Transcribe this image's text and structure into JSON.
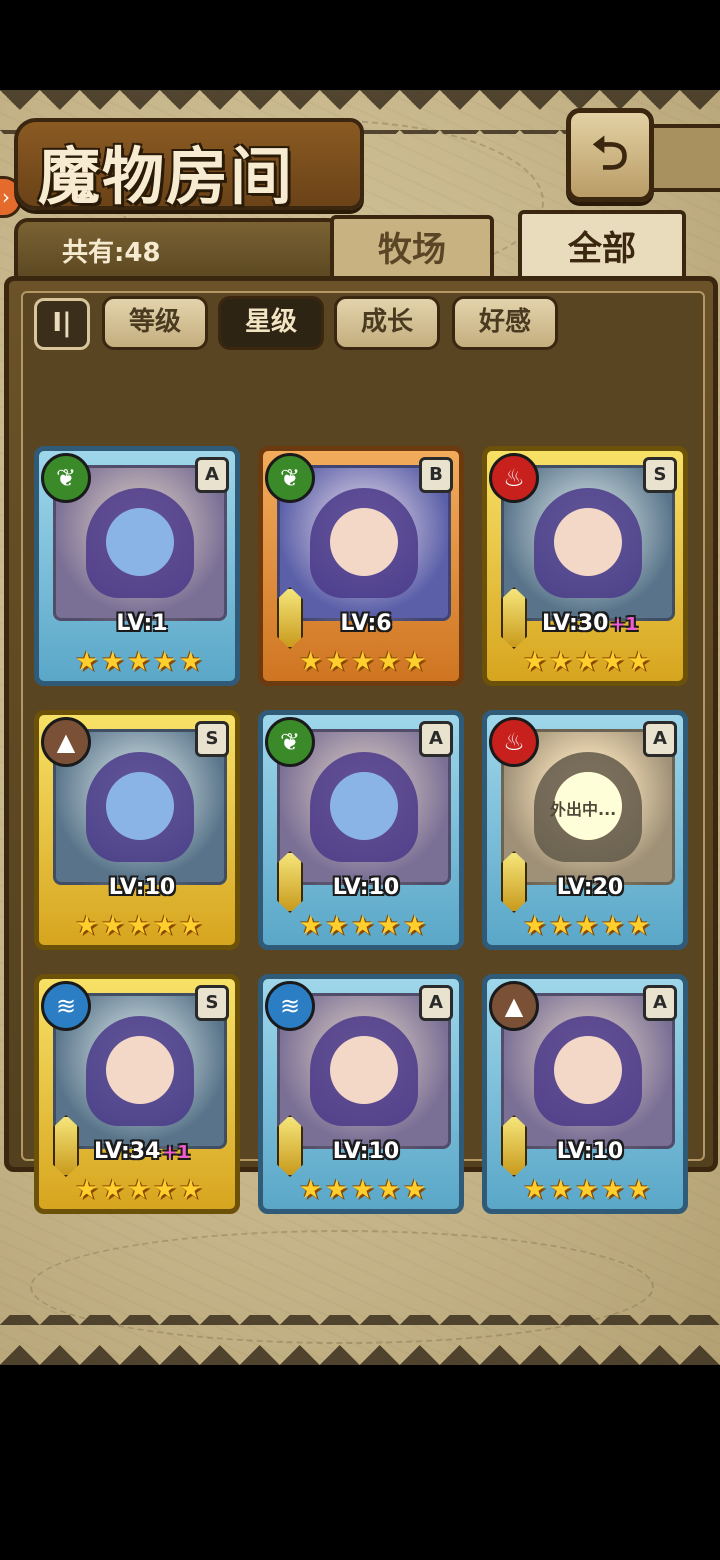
{
  "title": "魔物房间",
  "back_icon": "back-arrow-icon",
  "count_text": "共有:48",
  "tabs": [
    "牧场",
    "全部"
  ],
  "active_tab": "全部",
  "sort_toggle_label": "I|",
  "filters": [
    "等级",
    "星级",
    "成长",
    "好感"
  ],
  "active_filter": "星级",
  "cards": [
    {
      "element": "nature",
      "rank": "A",
      "level": "LV:1",
      "bonus": "",
      "stars": 5,
      "frame": "blue",
      "away": ""
    },
    {
      "element": "nature",
      "rank": "B",
      "level": "LV:6",
      "bonus": "",
      "stars": 5,
      "frame": "orange",
      "away": ""
    },
    {
      "element": "fire",
      "rank": "S",
      "level": "LV:30",
      "bonus": "+1",
      "stars": 5,
      "frame": "gold",
      "away": ""
    },
    {
      "element": "earth",
      "rank": "S",
      "level": "LV:10",
      "bonus": "",
      "stars": 5,
      "frame": "gold",
      "away": ""
    },
    {
      "element": "nature",
      "rank": "A",
      "level": "LV:10",
      "bonus": "",
      "stars": 5,
      "frame": "blue",
      "away": ""
    },
    {
      "element": "fire",
      "rank": "A",
      "level": "LV:20",
      "bonus": "",
      "stars": 5,
      "frame": "blue",
      "away": "外出中..."
    },
    {
      "element": "water",
      "rank": "S",
      "level": "LV:34",
      "bonus": "+1",
      "stars": 5,
      "frame": "gold",
      "away": ""
    },
    {
      "element": "water",
      "rank": "A",
      "level": "LV:10",
      "bonus": "",
      "stars": 5,
      "frame": "blue",
      "away": ""
    },
    {
      "element": "earth",
      "rank": "A",
      "level": "LV:10",
      "bonus": "",
      "stars": 5,
      "frame": "blue",
      "away": ""
    }
  ]
}
